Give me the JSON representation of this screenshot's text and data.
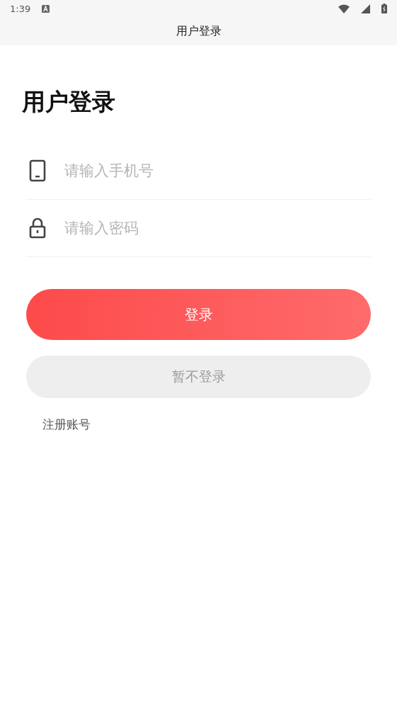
{
  "status_bar": {
    "time": "1:39"
  },
  "header": {
    "title": "用户登录"
  },
  "heading": "用户登录",
  "fields": [
    {
      "kind": "phone",
      "placeholder": "请输入手机号"
    },
    {
      "kind": "password",
      "placeholder": "请输入密码"
    }
  ],
  "login_button": "登录",
  "skip_button": "暂不登录",
  "register_link": "注册账号"
}
